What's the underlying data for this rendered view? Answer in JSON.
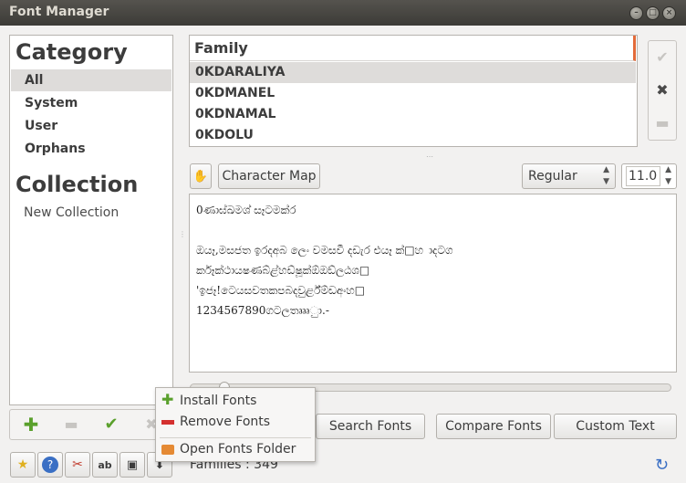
{
  "window": {
    "title": "Font Manager"
  },
  "category": {
    "heading": "Category",
    "items": [
      {
        "label": "All",
        "selected": true
      },
      {
        "label": "System",
        "selected": false
      },
      {
        "label": "User",
        "selected": false
      },
      {
        "label": "Orphans",
        "selected": false
      }
    ]
  },
  "collection": {
    "heading": "Collection",
    "items": [
      {
        "label": "New Collection"
      }
    ]
  },
  "family_list": {
    "header": "Family",
    "rows": [
      {
        "label": "0KDARALIYA",
        "selected": true
      },
      {
        "label": "0KDMANEL",
        "selected": false
      },
      {
        "label": "0KDNAMAL",
        "selected": false
      },
      {
        "label": "0KDOLU",
        "selected": false
      }
    ]
  },
  "preview_toolbar": {
    "character_map_label": "Character Map",
    "style_value": "Regular",
    "size_value": "11.0"
  },
  "preview": {
    "lines": [
      "0ණාඝ්ඛමශ් සෑටමක්ර",
      "",
      "ඔයෑ,මසජත ඉරදඅබ ලෙං වමසවී දඩැර එයෑ ක්□හ ාදටග",
      "ර්කෑක්ථායෂණබ්ළ්හඩ්ෂූක්ඕඔඞ්ලඨශ□",
      "'ඉජෑ!ටෙයසවතකපබදවුර්ළ්ම්ඩඅංහ□",
      "1234567890ගටලතෘෲුා.-"
    ]
  },
  "actions": {
    "search_fonts": "Search Fonts",
    "compare_fonts": "Compare Fonts",
    "custom_text": "Custom Text"
  },
  "context_menu": {
    "items": [
      {
        "label": "Install Fonts",
        "icon": "plus-icon"
      },
      {
        "label": "Remove Fonts",
        "icon": "minus-icon"
      },
      {
        "label": "Open Fonts Folder",
        "icon": "folder-icon"
      }
    ]
  },
  "status": {
    "families": "Families : 349"
  },
  "colors": {
    "accent": "#e36b3a",
    "plus": "#5aa02c",
    "minus": "#d4302f"
  }
}
